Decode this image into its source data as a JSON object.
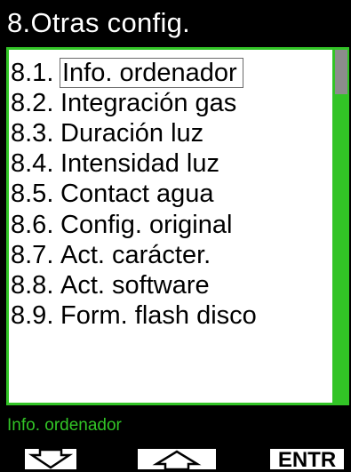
{
  "header": {
    "title": "8.Otras config."
  },
  "menu": {
    "selected_index": 0,
    "items": [
      {
        "num": "8.1.",
        "label": "Info. ordenador"
      },
      {
        "num": "8.2.",
        "label": "Integración gas"
      },
      {
        "num": "8.3.",
        "label": "Duración luz"
      },
      {
        "num": "8.4.",
        "label": "Intensidad luz"
      },
      {
        "num": "8.5.",
        "label": "Contact agua"
      },
      {
        "num": "8.6.",
        "label": "Config. original"
      },
      {
        "num": "8.7.",
        "label": "Act. carácter."
      },
      {
        "num": "8.8.",
        "label": "Act. software"
      },
      {
        "num": "8.9.",
        "label": "Form. flash disco"
      }
    ]
  },
  "status": {
    "text": "Info. ordenador"
  },
  "softkeys": {
    "left_icon": "arrow-down-icon",
    "middle_icon": "arrow-up-icon",
    "right_label": "ENTR"
  },
  "colors": {
    "background": "#000000",
    "accent_green": "#32c426",
    "list_background": "#ffffff",
    "scroll_thumb": "#8c8c8c"
  }
}
